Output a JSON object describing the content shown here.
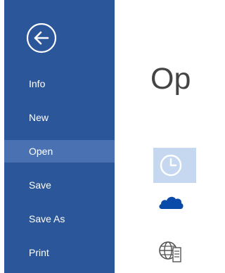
{
  "backstage": {
    "back_button": {
      "icon": "back-arrow-icon",
      "label": ""
    },
    "nav_items": [
      {
        "id": "info",
        "label": "Info",
        "selected": false
      },
      {
        "id": "new",
        "label": "New",
        "selected": false
      },
      {
        "id": "open",
        "label": "Open",
        "selected": true
      },
      {
        "id": "save",
        "label": "Save",
        "selected": false
      },
      {
        "id": "save-as",
        "label": "Save As",
        "selected": false
      },
      {
        "id": "print",
        "label": "Print",
        "selected": false
      }
    ]
  },
  "main": {
    "title": "Op",
    "locations": [
      {
        "icon": "clock-icon",
        "selected": true
      },
      {
        "icon": "onedrive-cloud-icon",
        "selected": false
      },
      {
        "icon": "globe-server-icon",
        "selected": false
      }
    ]
  },
  "colors": {
    "sidebar": "#2b579a",
    "sidebar_selected": "#4a72b3",
    "tile_selected": "#c5d8f0",
    "cloud": "#0a4aa8",
    "icon_stroke": "#ffffff"
  }
}
